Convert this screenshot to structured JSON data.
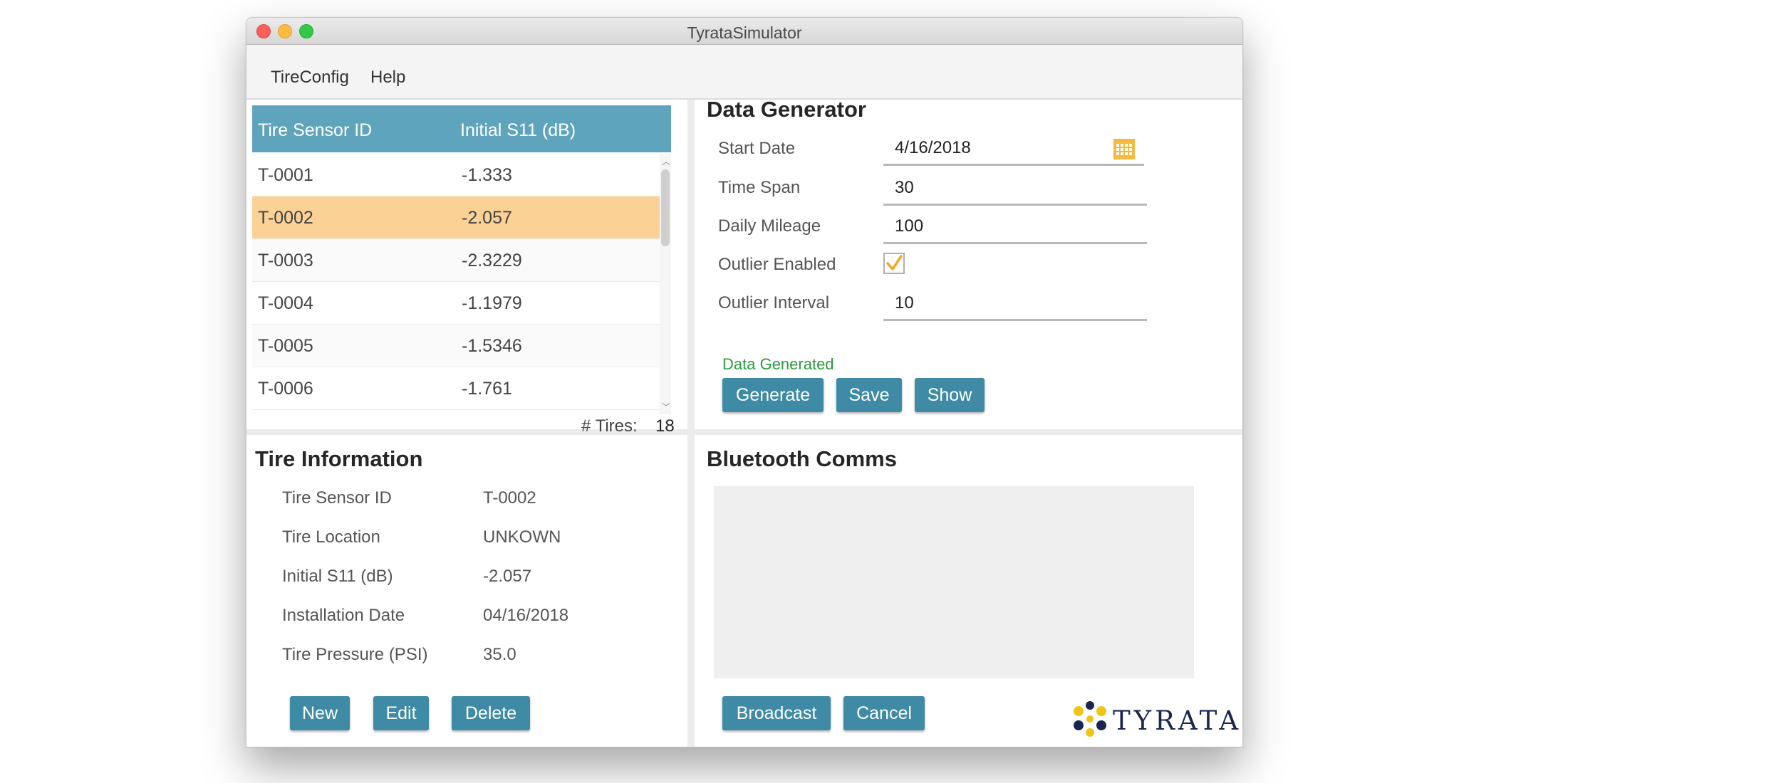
{
  "window": {
    "title": "TyrataSimulator"
  },
  "menu": {
    "items": [
      "TireConfig",
      "Help"
    ]
  },
  "tire_table": {
    "columns": [
      "Tire Sensor ID",
      "Initial S11 (dB)"
    ],
    "rows": [
      {
        "id": "T-0001",
        "s11": "-1.333"
      },
      {
        "id": "T-0002",
        "s11": "-2.057"
      },
      {
        "id": "T-0003",
        "s11": "-2.3229"
      },
      {
        "id": "T-0004",
        "s11": "-1.1979"
      },
      {
        "id": "T-0005",
        "s11": "-1.5346"
      },
      {
        "id": "T-0006",
        "s11": "-1.761"
      }
    ],
    "selected_id": "T-0002",
    "count_label": "# Tires:",
    "count_value": "18"
  },
  "tire_info": {
    "title": "Tire Information",
    "fields": [
      {
        "label": "Tire Sensor ID",
        "value": "T-0002"
      },
      {
        "label": "Tire Location",
        "value": "UNKOWN"
      },
      {
        "label": "Initial S11 (dB)",
        "value": "-2.057"
      },
      {
        "label": "Installation Date",
        "value": "04/16/2018"
      },
      {
        "label": "Tire Pressure (PSI)",
        "value": "35.0"
      }
    ],
    "buttons": {
      "new": "New",
      "edit": "Edit",
      "delete": "Delete"
    }
  },
  "data_generator": {
    "title": "Data Generator",
    "start_date": {
      "label": "Start Date",
      "value": "4/16/2018"
    },
    "time_span": {
      "label": "Time Span",
      "value": "30"
    },
    "daily_mileage": {
      "label": "Daily Mileage",
      "value": "100"
    },
    "outlier_enabled": {
      "label": "Outlier Enabled",
      "checked": true
    },
    "outlier_interval": {
      "label": "Outlier Interval",
      "value": "10"
    },
    "status": "Data Generated",
    "buttons": {
      "generate": "Generate",
      "save": "Save",
      "show": "Show"
    }
  },
  "bluetooth": {
    "title": "Bluetooth Comms",
    "buttons": {
      "broadcast": "Broadcast",
      "cancel": "Cancel"
    }
  },
  "logo": {
    "text": "TYRATA"
  },
  "colors": {
    "header_blue": "#5fa4bd",
    "button_blue": "#3f8ba5",
    "selected_row": "#fcd196",
    "status_green": "#2a9d3a",
    "checkbox_orange": "#f5a623",
    "calendar_orange": "#f5b942"
  },
  "icons": {
    "calendar": "calendar-icon",
    "check": "checkmark-icon",
    "logo": "tyrata-logo-icon"
  }
}
